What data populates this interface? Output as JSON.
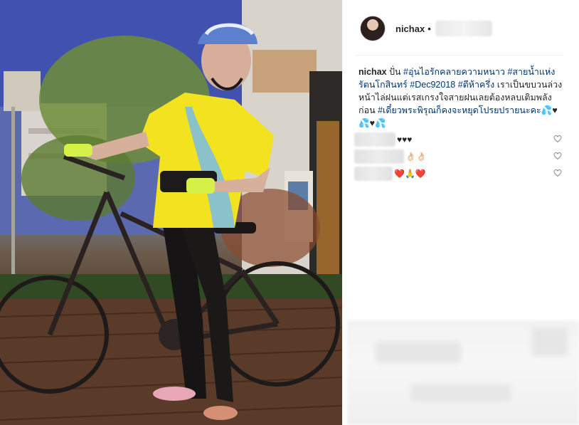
{
  "post": {
    "username": "nichax",
    "separator": "•",
    "caption": {
      "user": "nichax",
      "text_1": " ปั่น ",
      "tag_1": "#อุ่นไอรักคลายความหนาว",
      "text_2": " ",
      "tag_2": "#สายน้ำแห่งรัตนโกสินทร์",
      "text_3": " ",
      "tag_3": "#Dec92018",
      "text_4": " ",
      "tag_4": "#ตีห้าครึ่ง",
      "text_5": " เราเป็นขบวนล่วงหน้าไล่ฝนแต่เรสเกรงใจสายฝนเลยต้องหลบเติมพลังก่อน ",
      "tag_5": "#เดี๋ยวพระพิรุณก็คงจะหยุดโปรยปรายนะคะ",
      "text_6": "💦♥💦♥💦"
    },
    "comments": [
      {
        "text": "♥♥♥"
      },
      {
        "text": "👌🏻👌🏻"
      },
      {
        "text": "❤️🙏❤️"
      }
    ]
  },
  "colors": {
    "hashtag": "#003569",
    "text": "#262626",
    "divider": "#efefef"
  },
  "icons": [
    "heart-outline-icon",
    "avatar"
  ]
}
